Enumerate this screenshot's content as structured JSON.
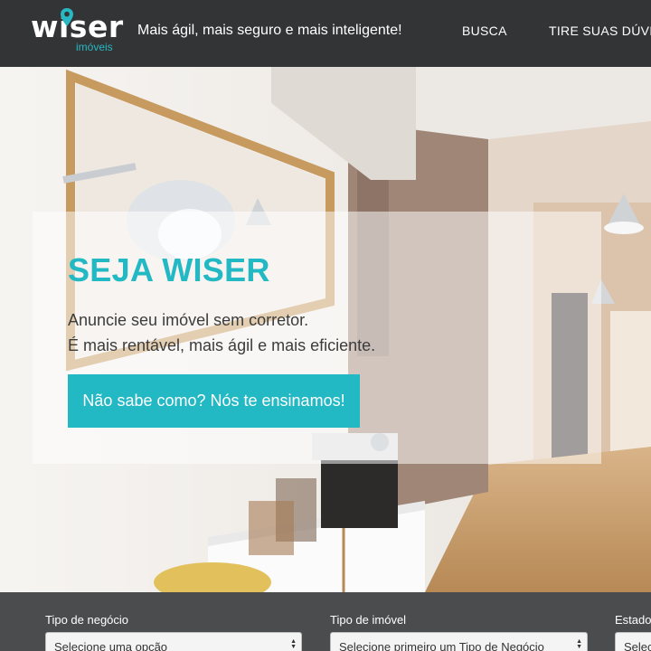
{
  "header": {
    "logo_text": "wiser",
    "logo_subtext": "imóveis",
    "tagline": "Mais ágil, mais seguro e mais inteligente!",
    "nav": [
      {
        "label": "BUSCA"
      },
      {
        "label": "TIRE SUAS DÚVIDAS"
      }
    ]
  },
  "hero": {
    "title": "SEJA WISER",
    "line1": "Anuncie seu imóvel sem corretor.",
    "line2": "É mais rentável, mais ágil e mais eficiente.",
    "cta_label": "Não sabe como? Nós te ensinamos!"
  },
  "search": {
    "fields": [
      {
        "label": "Tipo de negócio",
        "value": "Selecione uma opção"
      },
      {
        "label": "Tipo de imóvel",
        "value": "Selecione primeiro um Tipo de Negócio"
      },
      {
        "label": "Estado",
        "value": "Selecione"
      }
    ]
  },
  "colors": {
    "brand_teal": "#22b8c4",
    "header_bg": "#323436",
    "search_bg": "#4a4c4d"
  },
  "icons": {
    "logo_pin": "map-pin-icon",
    "select_arrows": "up-down-arrows-icon"
  }
}
